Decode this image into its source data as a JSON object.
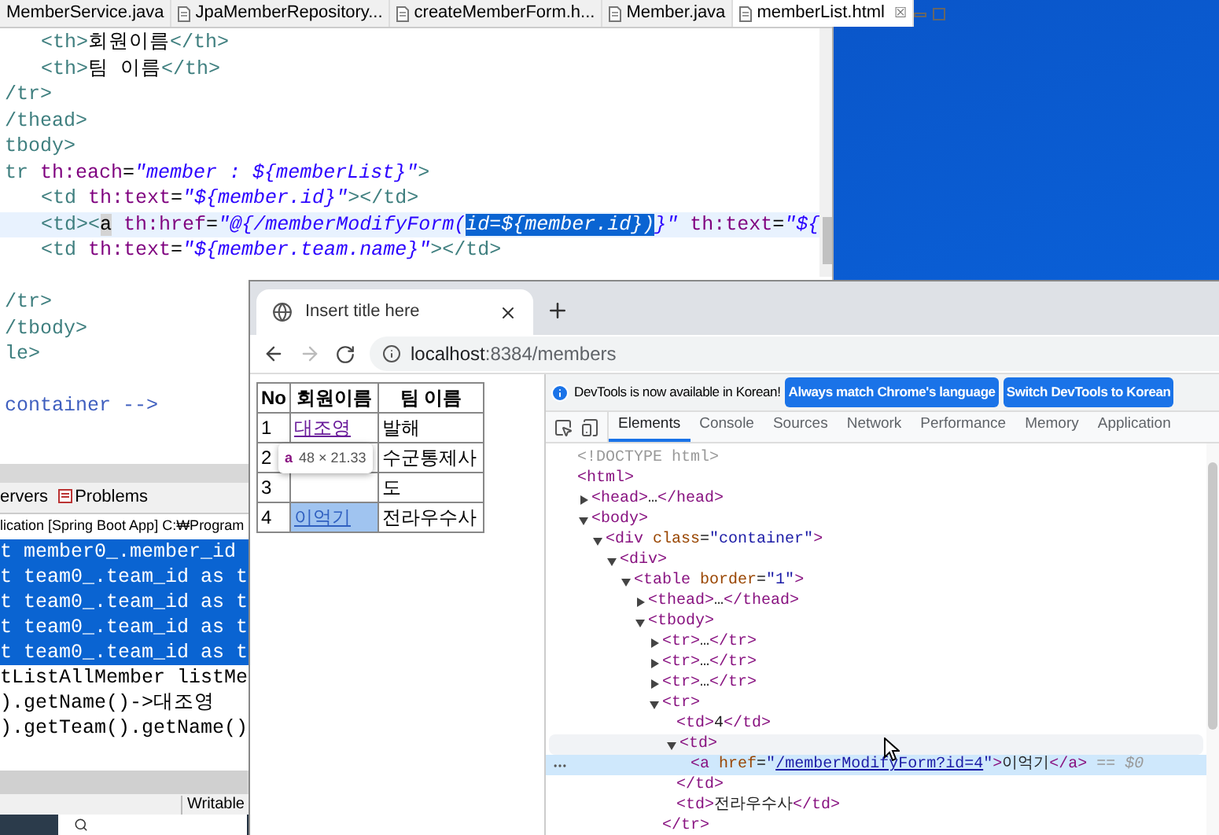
{
  "editor": {
    "tabs": [
      {
        "label": "MemberService.java",
        "selected": false,
        "icon": false
      },
      {
        "label": "JpaMemberRepository...",
        "selected": false,
        "icon": true
      },
      {
        "label": "createMemberForm.h...",
        "selected": false,
        "icon": true
      },
      {
        "label": "Member.java",
        "selected": false,
        "icon": true
      },
      {
        "label": "memberList.html",
        "selected": true,
        "icon": true,
        "close": "☒"
      }
    ],
    "lines": [
      {
        "kind": "code",
        "indented": true,
        "current": false,
        "parts": [
          {
            "kind": "tag",
            "t": "<th>"
          },
          {
            "kind": "text",
            "t": "회원이름"
          },
          {
            "kind": "tag",
            "t": "</th>"
          }
        ]
      },
      {
        "kind": "code",
        "indented": true,
        "current": false,
        "parts": [
          {
            "kind": "tag",
            "t": "<th>"
          },
          {
            "kind": "text",
            "t": "팀 이름"
          },
          {
            "kind": "tag",
            "t": "</th>"
          }
        ]
      },
      {
        "kind": "code",
        "indented": false,
        "current": false,
        "parts": [
          {
            "kind": "tag",
            "t": "/tr>"
          }
        ]
      },
      {
        "kind": "code",
        "indented": false,
        "current": false,
        "parts": [
          {
            "kind": "tag",
            "t": "/thead>"
          }
        ]
      },
      {
        "kind": "code",
        "indented": false,
        "current": false,
        "parts": [
          {
            "kind": "tag",
            "t": "tbody>"
          }
        ]
      },
      {
        "kind": "code",
        "indented": false,
        "current": false,
        "parts": [
          {
            "kind": "tag",
            "t": "tr "
          },
          {
            "kind": "attr",
            "t": "th:each"
          },
          {
            "kind": "text",
            "t": "="
          },
          {
            "kind": "str",
            "t": "\"member : ${memberList}\""
          },
          {
            "kind": "tag",
            "t": ">"
          }
        ]
      },
      {
        "kind": "code",
        "indented": true,
        "current": false,
        "parts": [
          {
            "kind": "tag",
            "t": "<td "
          },
          {
            "kind": "attr",
            "t": "th:text"
          },
          {
            "kind": "text",
            "t": "="
          },
          {
            "kind": "str",
            "t": "\"${member.id}\""
          },
          {
            "kind": "tag",
            "t": "></td>"
          }
        ]
      },
      {
        "kind": "code",
        "indented": true,
        "current": true,
        "parts": [
          {
            "kind": "tag",
            "t": "<td><"
          },
          {
            "kind": "match",
            "t": "a"
          },
          {
            "kind": "attr",
            "t": " th:href"
          },
          {
            "kind": "text",
            "t": "="
          },
          {
            "kind": "str",
            "t": "\"@{/memberModifyForm("
          },
          {
            "kind": "sel",
            "t": "id=${member.id})"
          },
          {
            "kind": "str",
            "t": "}\""
          },
          {
            "kind": "attr",
            "t": " th:text"
          },
          {
            "kind": "text",
            "t": "="
          },
          {
            "kind": "str",
            "t": "\"${"
          }
        ]
      },
      {
        "kind": "code",
        "indented": true,
        "current": false,
        "parts": [
          {
            "kind": "tag",
            "t": "<td "
          },
          {
            "kind": "attr",
            "t": "th:text"
          },
          {
            "kind": "text",
            "t": "="
          },
          {
            "kind": "str",
            "t": "\"${member.team.name}\""
          },
          {
            "kind": "tag",
            "t": "></td>"
          }
        ]
      },
      {
        "kind": "blank"
      },
      {
        "kind": "code",
        "indented": false,
        "current": false,
        "parts": [
          {
            "kind": "tag",
            "t": "/tr>"
          }
        ]
      },
      {
        "kind": "code",
        "indented": false,
        "current": false,
        "parts": [
          {
            "kind": "tag",
            "t": "/tbody>"
          }
        ]
      },
      {
        "kind": "code",
        "indented": false,
        "current": false,
        "parts": [
          {
            "kind": "tag",
            "t": "le>"
          }
        ]
      },
      {
        "kind": "blank"
      },
      {
        "kind": "code",
        "indented": false,
        "current": false,
        "parts": [
          {
            "kind": "comment",
            "t": "container -->"
          }
        ]
      }
    ]
  },
  "views": {
    "tabs": [
      {
        "label": "ervers",
        "icon": false
      },
      {
        "label": "Problems",
        "icon": true
      }
    ],
    "console_title": "lication [Spring Boot App] C:₩Program",
    "console_lines": [
      {
        "text": "t member0_.member_id",
        "selected": true
      },
      {
        "text": "t team0_.team_id as t",
        "selected": true
      },
      {
        "text": "t team0_.team_id as t",
        "selected": true
      },
      {
        "text": "t team0_.team_id as t",
        "selected": true
      },
      {
        "text": "t team0_.team_id as t",
        "selected": true
      },
      {
        "text": "tListAllMember listMe",
        "selected": false
      },
      {
        "text": ").getName()->대조영",
        "selected": false
      },
      {
        "text": ").getTeam().getName()",
        "selected": false
      }
    ],
    "status": "Writable"
  },
  "browser": {
    "tab_title": "Insert title here",
    "url_host": "localhost",
    "url_path": ":8384/members",
    "table": {
      "columns": [
        "No",
        "회원이름",
        "팀 이름"
      ],
      "rows": [
        {
          "no": "1",
          "name": "대조영",
          "team": "발해",
          "highlighted": false
        },
        {
          "no": "2",
          "team": "수군통제사",
          "highlighted": false
        },
        {
          "no": "3",
          "team": "도",
          "highlighted": false
        },
        {
          "no": "4",
          "name": "이억기",
          "team": "전라우수사",
          "highlighted": true
        }
      ]
    },
    "tooltip": {
      "tag": "a",
      "size": "48 × 21.33"
    }
  },
  "devtools": {
    "notice": "DevTools is now available in Korean!",
    "notice_buttons": [
      "Always match Chrome's language",
      "Switch DevTools to Korean"
    ],
    "tabs": [
      {
        "label": "Elements",
        "selected": true
      },
      {
        "label": "Console",
        "selected": false
      },
      {
        "label": "Sources",
        "selected": false
      },
      {
        "label": "Network",
        "selected": false
      },
      {
        "label": "Performance",
        "selected": false
      },
      {
        "label": "Memory",
        "selected": false
      },
      {
        "label": "Application",
        "selected": false
      }
    ],
    "tree": [
      {
        "parts": [
          {
            "kind": "doctype",
            "t": "<!DOCTYPE html>"
          }
        ],
        "selected": false,
        "hovered": false
      },
      {
        "parts": [
          {
            "kind": "tag",
            "t": "<html>"
          }
        ],
        "selected": false,
        "hovered": false,
        "children": [
          {
            "parts": [
              {
                "kind": "tag",
                "t": "<head>"
              },
              {
                "kind": "text",
                "t": "…"
              },
              {
                "kind": "tag",
                "t": "</head>"
              }
            ],
            "expanded": false,
            "selected": false,
            "hovered": false
          },
          {
            "parts": [
              {
                "kind": "tag",
                "t": "<body>"
              }
            ],
            "expanded": true,
            "selected": false,
            "hovered": false,
            "children": [
              {
                "parts": [
                  {
                    "kind": "tag",
                    "t": "<div"
                  },
                  {
                    "kind": "attr",
                    "t": " class"
                  },
                  {
                    "kind": "text",
                    "t": "="
                  },
                  {
                    "kind": "val",
                    "t": "\"container\""
                  },
                  {
                    "kind": "tag",
                    "t": ">"
                  }
                ],
                "expanded": true,
                "selected": false,
                "hovered": false,
                "children": [
                  {
                    "parts": [
                      {
                        "kind": "tag",
                        "t": "<div>"
                      }
                    ],
                    "expanded": true,
                    "selected": false,
                    "hovered": false,
                    "children": [
                      {
                        "parts": [
                          {
                            "kind": "tag",
                            "t": "<table"
                          },
                          {
                            "kind": "attr",
                            "t": " border"
                          },
                          {
                            "kind": "text",
                            "t": "="
                          },
                          {
                            "kind": "val",
                            "t": "\"1\""
                          },
                          {
                            "kind": "tag",
                            "t": ">"
                          }
                        ],
                        "expanded": true,
                        "selected": false,
                        "hovered": false,
                        "children": [
                          {
                            "parts": [
                              {
                                "kind": "tag",
                                "t": "<thead>"
                              },
                              {
                                "kind": "text",
                                "t": "…"
                              },
                              {
                                "kind": "tag",
                                "t": "</thead>"
                              }
                            ],
                            "expanded": false,
                            "selected": false,
                            "hovered": false
                          },
                          {
                            "parts": [
                              {
                                "kind": "tag",
                                "t": "<tbody>"
                              }
                            ],
                            "expanded": true,
                            "selected": false,
                            "hovered": false,
                            "children": [
                              {
                                "parts": [
                                  {
                                    "kind": "tag",
                                    "t": "<tr>"
                                  },
                                  {
                                    "kind": "text",
                                    "t": "…"
                                  },
                                  {
                                    "kind": "tag",
                                    "t": "</tr>"
                                  }
                                ],
                                "expanded": false,
                                "selected": false,
                                "hovered": false
                              },
                              {
                                "parts": [
                                  {
                                    "kind": "tag",
                                    "t": "<tr>"
                                  },
                                  {
                                    "kind": "text",
                                    "t": "…"
                                  },
                                  {
                                    "kind": "tag",
                                    "t": "</tr>"
                                  }
                                ],
                                "expanded": false,
                                "selected": false,
                                "hovered": false
                              },
                              {
                                "parts": [
                                  {
                                    "kind": "tag",
                                    "t": "<tr>"
                                  },
                                  {
                                    "kind": "text",
                                    "t": "…"
                                  },
                                  {
                                    "kind": "tag",
                                    "t": "</tr>"
                                  }
                                ],
                                "expanded": false,
                                "selected": false,
                                "hovered": false
                              },
                              {
                                "parts": [
                                  {
                                    "kind": "tag",
                                    "t": "<tr>"
                                  }
                                ],
                                "expanded": true,
                                "selected": false,
                                "hovered": false,
                                "closing": "</tr>",
                                "children": [
                                  {
                                    "parts": [
                                      {
                                        "kind": "tag",
                                        "t": "<td>"
                                      },
                                      {
                                        "kind": "text",
                                        "t": "4"
                                      },
                                      {
                                        "kind": "tag",
                                        "t": "</td>"
                                      }
                                    ],
                                    "selected": false,
                                    "hovered": false
                                  },
                                  {
                                    "parts": [
                                      {
                                        "kind": "tag",
                                        "t": "<td>"
                                      }
                                    ],
                                    "expanded": true,
                                    "selected": false,
                                    "hovered": true,
                                    "closing": "</td>",
                                    "children": [
                                      {
                                        "parts": [
                                          {
                                            "kind": "tag",
                                            "t": "<a"
                                          },
                                          {
                                            "kind": "attr",
                                            "t": " href"
                                          },
                                          {
                                            "kind": "text",
                                            "t": "="
                                          },
                                          {
                                            "kind": "val",
                                            "t": "\""
                                          },
                                          {
                                            "kind": "link",
                                            "t": "/memberModifyForm?id=4"
                                          },
                                          {
                                            "kind": "val",
                                            "t": "\""
                                          },
                                          {
                                            "kind": "tag",
                                            "t": ">"
                                          },
                                          {
                                            "kind": "text",
                                            "t": "이억기"
                                          },
                                          {
                                            "kind": "tag",
                                            "t": "</a>"
                                          },
                                          {
                                            "kind": "dim",
                                            "t": " == $0"
                                          }
                                        ],
                                        "selected": true,
                                        "hovered": false
                                      }
                                    ]
                                  },
                                  {
                                    "parts": [
                                      {
                                        "kind": "tag",
                                        "t": "<td>"
                                      },
                                      {
                                        "kind": "text",
                                        "t": "전라우수사"
                                      },
                                      {
                                        "kind": "tag",
                                        "t": "</td>"
                                      }
                                    ],
                                    "selected": false,
                                    "hovered": false
                                  }
                                ]
                              }
                            ]
                          }
                        ]
                      }
                    ]
                  }
                ]
              }
            ]
          }
        ]
      }
    ]
  }
}
